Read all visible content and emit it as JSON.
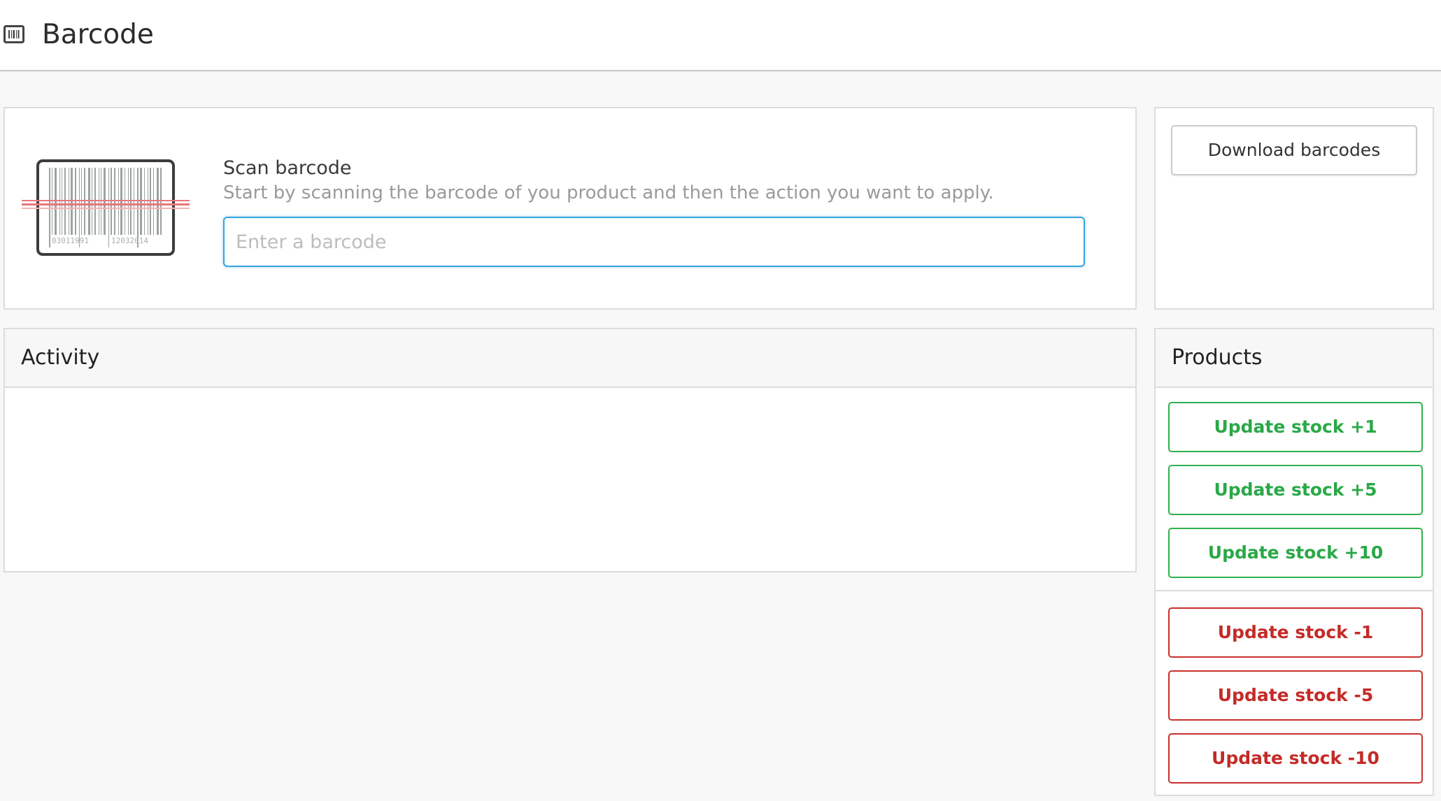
{
  "app": {
    "title": "Barcode",
    "icon": "barcode-icon"
  },
  "scan": {
    "label": "Scan barcode",
    "help": "Start by scanning the barcode of you product and then the action you want to apply.",
    "placeholder": "Enter a barcode",
    "value": "",
    "illustration_digits_left": "03011991",
    "illustration_digits_right": "12032014"
  },
  "download": {
    "label": "Download barcodes"
  },
  "activity": {
    "title": "Activity",
    "items": []
  },
  "products": {
    "title": "Products",
    "increase_buttons": [
      {
        "label": "Update stock +1"
      },
      {
        "label": "Update stock +5"
      },
      {
        "label": "Update stock +10"
      }
    ],
    "decrease_buttons": [
      {
        "label": "Update stock -1"
      },
      {
        "label": "Update stock -5"
      },
      {
        "label": "Update stock -10"
      }
    ]
  },
  "colors": {
    "accent_blue": "#36a3de",
    "success_green": "#2aa847",
    "danger_red": "#c42b27",
    "scan_line_red": "#e8767a"
  }
}
